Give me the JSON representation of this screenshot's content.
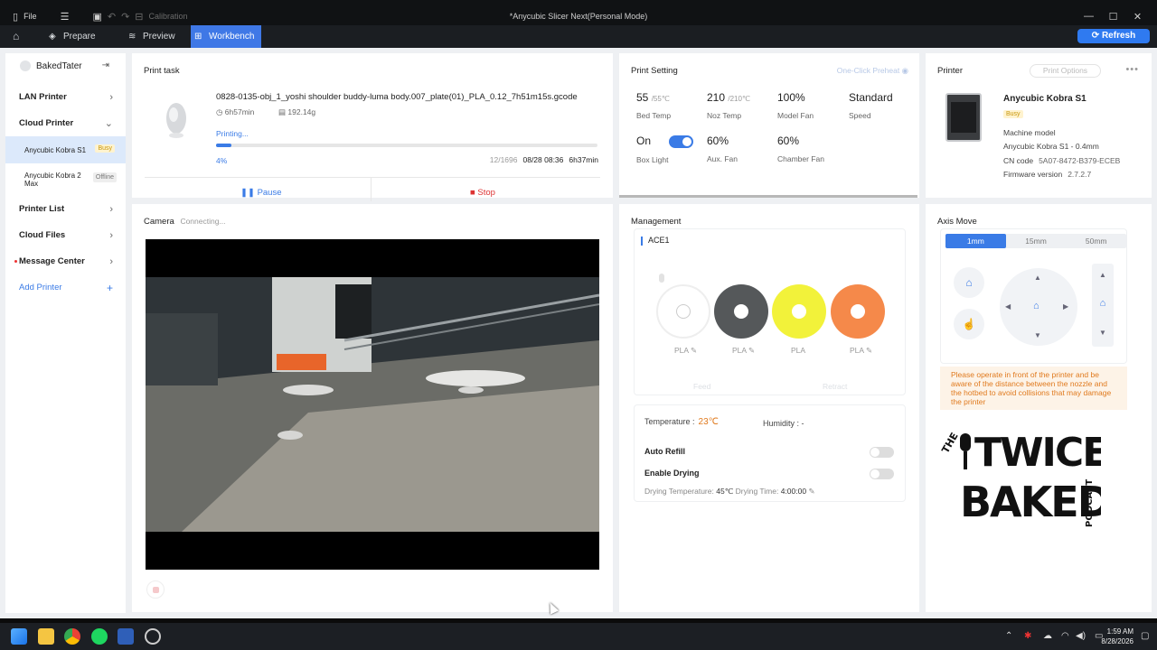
{
  "titlebar": {
    "file_label": "File",
    "calibration_label": "Calibration",
    "title": "*Anycubic Slicer Next(Personal Mode)"
  },
  "nav": {
    "tabs": [
      {
        "label": "Prepare"
      },
      {
        "label": "Preview"
      },
      {
        "label": "Workbench"
      }
    ],
    "refresh_label": "Refresh"
  },
  "sidebar": {
    "username": "BakedTater",
    "lan_printer": "LAN Printer",
    "cloud_printer": "Cloud Printer",
    "printers": [
      {
        "name": "Anycubic Kobra S1",
        "status": "Busy"
      },
      {
        "name": "Anycubic Kobra 2 Max",
        "status": "Offline"
      }
    ],
    "printer_list": "Printer List",
    "cloud_files": "Cloud Files",
    "message_center": "Message Center",
    "add_printer": "Add Printer"
  },
  "print_task": {
    "header": "Print task",
    "filename": "0828-0135-obj_1_yoshi shoulder buddy-luma body.007_plate(01)_PLA_0.12_7h51m15s.gcode",
    "duration": "6h57min",
    "weight": "192.14g",
    "status": "Printing...",
    "progress": 0.04,
    "percent": "4%",
    "layers": "12/1696",
    "finish_time": "08/28 08:36",
    "remaining": "6h37min",
    "pause_label": "Pause",
    "stop_label": "Stop"
  },
  "camera": {
    "header": "Camera",
    "status": "Connecting..."
  },
  "print_setting": {
    "header": "Print Setting",
    "preheat_label": "One-Click Preheat",
    "bed_temp": "55",
    "bed_target": "/55℃",
    "bed_label": "Bed Temp",
    "noz_temp": "210",
    "noz_target": "/210℃",
    "noz_label": "Noz Temp",
    "model_fan": "100%",
    "model_fan_label": "Model Fan",
    "speed": "Standard",
    "speed_label": "Speed",
    "box_light": "On",
    "box_light_label": "Box Light",
    "aux_fan": "60%",
    "aux_fan_label": "Aux. Fan",
    "chamber_fan": "60%",
    "chamber_fan_label": "Chamber Fan"
  },
  "printer": {
    "header": "Printer",
    "options_label": "Print Options",
    "name": "Anycubic Kobra S1",
    "status": "Busy",
    "machine_model_label": "Machine model",
    "machine_model": "Anycubic Kobra S1 - 0.4mm",
    "cn_code_label": "CN code",
    "cn_code": "5A07-8472-B379-ECEB",
    "firmware_label": "Firmware version",
    "firmware": "2.7.2.7"
  },
  "management": {
    "header": "Management",
    "ace_label": "ACE1",
    "slots": [
      {
        "material": "PLA",
        "color": "#ffffff"
      },
      {
        "material": "PLA",
        "color": "#55585a"
      },
      {
        "material": "PLA",
        "color": "#f2f23a"
      },
      {
        "material": "PLA",
        "color": "#f5894a"
      }
    ],
    "feed_label": "Feed",
    "retract_label": "Retract",
    "temperature_label": "Temperature :",
    "temperature": "23℃",
    "humidity_label": "Humidity :",
    "humidity": "-",
    "auto_refill": "Auto Refill",
    "enable_drying": "Enable Drying",
    "drying_temp_label": "Drying Temperature:",
    "drying_temp": "45℃",
    "drying_time_label": "Drying Time:",
    "drying_time": "4:00:00"
  },
  "axis_move": {
    "header": "Axis Move",
    "steps": [
      "1mm",
      "15mm",
      "50mm"
    ],
    "warning": "Please operate in front of the printer and be aware of the distance between the nozzle and the hotbed to avoid collisions that may damage the printer",
    "logo_the": "THE",
    "logo_twice": "TWICE",
    "logo_baked": "BAKED",
    "logo_podcast": "PODCAST"
  },
  "taskbar": {
    "time": "1:59 AM",
    "date": "8/28/2026"
  },
  "colors": {
    "accent": "#3a7be6",
    "stop": "#dd3333",
    "warning": "#e07a1e"
  }
}
